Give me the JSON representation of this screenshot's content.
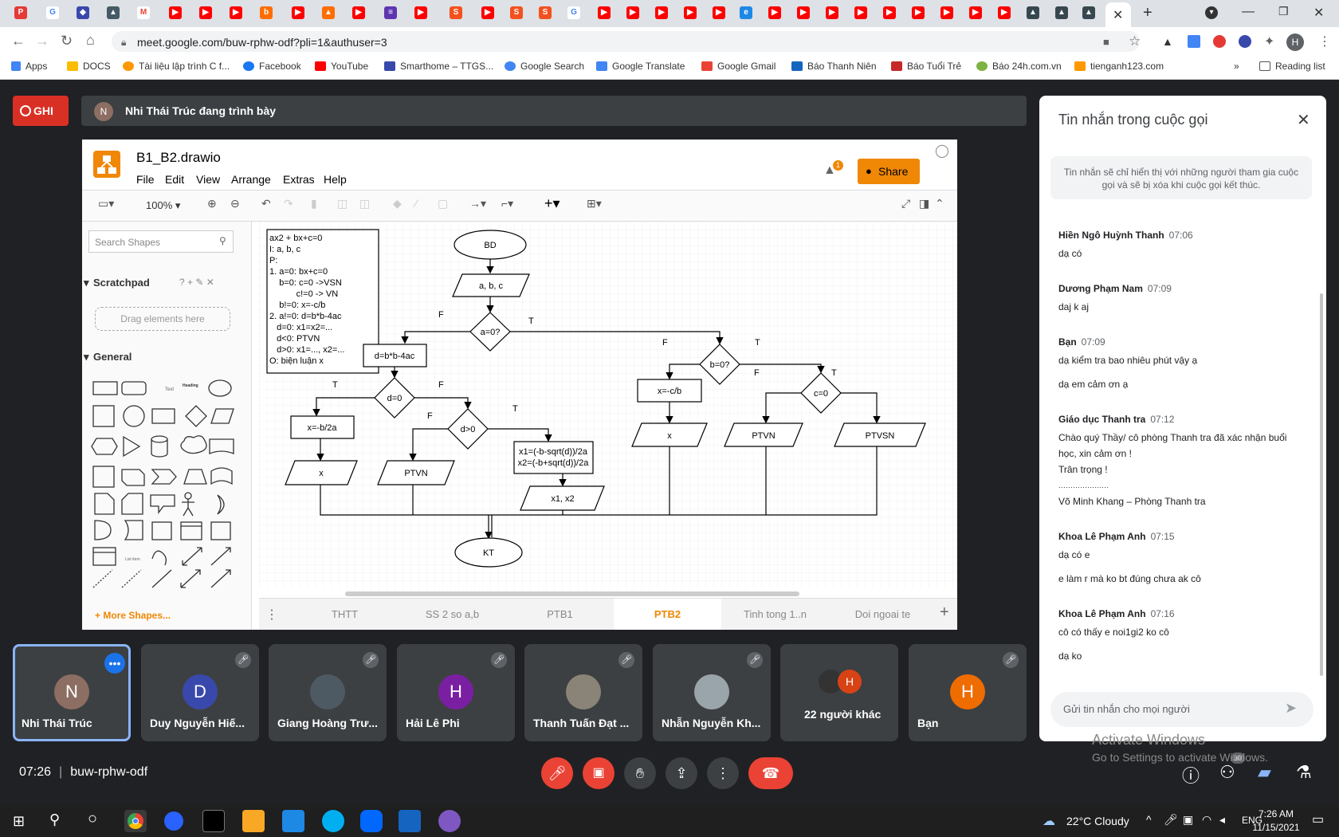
{
  "browser": {
    "url": "meet.google.com/buw-rphw-odf?pli=1&authuser=3",
    "bookmarks": [
      "Apps",
      "DOCS",
      "Tài liệu lập trình C f...",
      "Facebook",
      "YouTube",
      "Smarthome – TTGS...",
      "Google Search",
      "Google Translate",
      "Google Gmail",
      "Báo Thanh Niên",
      "Báo Tuổi Trẻ",
      "Báo 24h.com.vn",
      "tienganh123.com"
    ],
    "reading_list": "Reading list",
    "avatar_letter": "H"
  },
  "meet": {
    "recording_label": "GHI",
    "presenter_letter": "N",
    "presenting_text": "Nhi Thái Trúc đang trình bày",
    "meeting_time": "07:26",
    "meeting_code": "buw-rphw-odf",
    "people_count": "30"
  },
  "drawio": {
    "title": "B1_B2.drawio",
    "menu": [
      "File",
      "Edit",
      "View",
      "Arrange",
      "Extras",
      "Help"
    ],
    "share_label": "Share",
    "notification_count": "1",
    "zoom": "100%",
    "search_placeholder": "Search Shapes",
    "scratchpad_label": "Scratchpad",
    "drag_hint": "Drag elements here",
    "general_label": "General",
    "more_shapes": "More Shapes...",
    "sheets": [
      "THTT",
      "SS 2 so a,b",
      "PTB1",
      "PTB2",
      "Tinh tong 1..n",
      "Doi ngoai te"
    ],
    "active_sheet": "PTB2",
    "notes": [
      "ax2 + bx+c=0",
      "I: a, b, c",
      "P:",
      "1. a=0: bx+c=0",
      "    b=0: c=0 ->VSN",
      "           c!=0 -> VN",
      "    b!=0: x=-c/b",
      "2. a!=0: d=b*b-4ac",
      "   d=0: x1=x2=...",
      "   d<0: PTVN",
      "   d>0: x1=..., x2=...",
      "O: biện luận x"
    ],
    "nodes": {
      "bd": "BD",
      "input": "a, b, c",
      "a0": "a=0?",
      "delta": "d=b*b-4ac",
      "d0": "d=0",
      "dpos": "d>0",
      "xb2a": "x=-b/2a",
      "xout1": "x",
      "ptvn1": "PTVN",
      "formula1": "x1=(-b-sqrt(d))/2a",
      "formula2": "x2=(-b+sqrt(d))/2a",
      "x1x2": "x1, x2",
      "b0": "b=0?",
      "xcb": "x=-c/b",
      "xout2": "x",
      "c0": "c=0",
      "ptvn2": "PTVN",
      "ptvsn": "PTVSN",
      "kt": "KT"
    },
    "edge_labels": {
      "f": "F",
      "t": "T"
    }
  },
  "chat": {
    "title": "Tin nhắn trong cuộc gọi",
    "notice": "Tin nhắn sẽ chỉ hiển thị với những người tham gia cuộc gọi và sẽ bị xóa khi cuộc gọi kết thúc.",
    "messages": [
      {
        "name": "Hiền Ngô Huỳnh Thanh",
        "time": "07:06",
        "lines": [
          "dạ có"
        ]
      },
      {
        "name": "Dương Phạm Nam",
        "time": "07:09",
        "lines": [
          "daj k aj"
        ]
      },
      {
        "name": "Bạn",
        "time": "07:09",
        "lines": [
          "dạ kiểm tra bao nhiêu phút vậy ạ",
          "dạ em cảm ơn ạ"
        ]
      },
      {
        "name": "Giáo dục Thanh tra",
        "time": "07:12",
        "lines": [
          "Chào quý Thầy/ cô phòng Thanh tra đã xác nhận buổi học, xin cảm ơn !",
          "Trân trọng !",
          "…………………",
          "Võ Minh Khang – Phòng Thanh tra"
        ]
      },
      {
        "name": "Khoa Lê Phạm Anh",
        "time": "07:15",
        "lines": [
          "dạ có e",
          "e làm r mà ko bt đúng chưa ak cô"
        ]
      },
      {
        "name": "Khoa Lê Phạm Anh",
        "time": "07:16",
        "lines": [
          "cô có thấy e noi1gi2 ko cô",
          "dạ ko"
        ]
      }
    ],
    "input_placeholder": "Gửi tin nhắn cho mọi người"
  },
  "participants": [
    {
      "name": "Nhi Thái Trúc",
      "letter": "N",
      "color": "#8d6e63"
    },
    {
      "name": "Duy Nguyễn Hiế...",
      "letter": "D",
      "color": "#3949ab"
    },
    {
      "name": "Giang Hoàng Trư...",
      "letter": "",
      "color": "#4e5a63"
    },
    {
      "name": "Hải Lê Phi",
      "letter": "H",
      "color": "#7b1fa2"
    },
    {
      "name": "Thanh Tuấn Đạt ...",
      "letter": "",
      "color": "#8a8478"
    },
    {
      "name": "Nhẫn Nguyễn Kh...",
      "letter": "",
      "color": "#9aa5ab"
    },
    {
      "name": "22 người khác",
      "letter": "H",
      "color": "#d84315"
    },
    {
      "name": "Bạn",
      "letter": "H",
      "color": "#ef6c00"
    }
  ],
  "watermark": {
    "title": "Activate Windows",
    "subtitle": "Go to Settings to activate Windows."
  },
  "taskbar": {
    "weather": "22°C  Cloudy",
    "lang": "ENG",
    "time": "7:26 AM",
    "date": "11/15/2021"
  }
}
